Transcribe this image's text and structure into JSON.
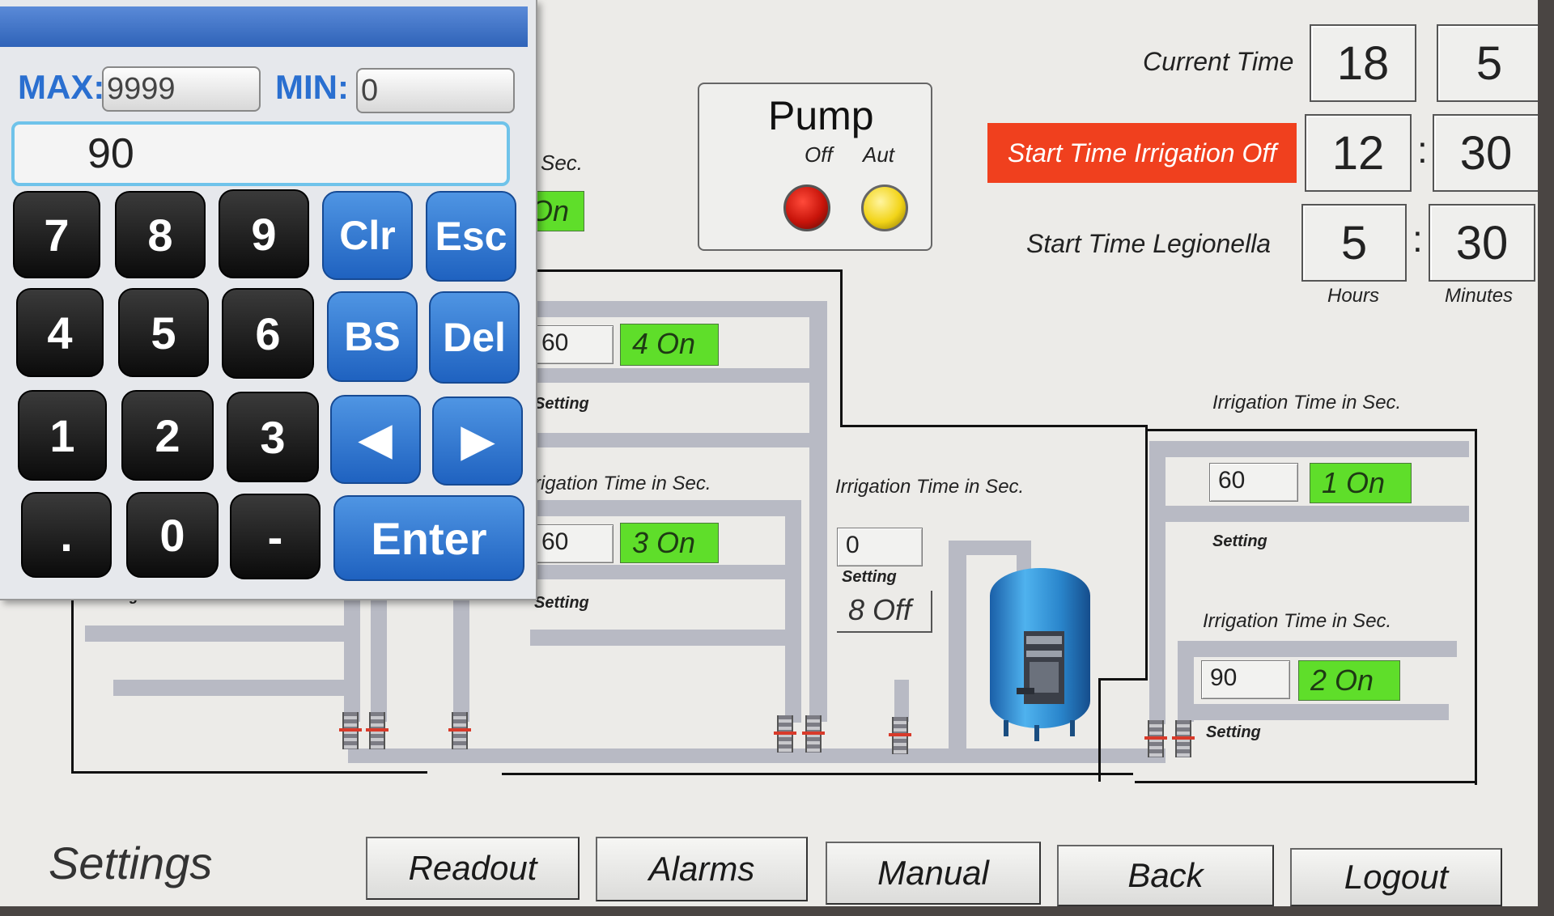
{
  "header": {
    "current_time_label": "Current Time",
    "current_time_hour": "18",
    "current_time_minute": "5",
    "start_irrigation_button": "Start Time Irrigation Off",
    "start_irrigation_hour": "12",
    "start_irrigation_minute": "30",
    "legionella_label": "Start Time Legionella",
    "legionella_hour": "5",
    "legionella_minute": "30",
    "hours_label": "Hours",
    "minutes_label": "Minutes",
    "colon": ":"
  },
  "pump": {
    "title": "Pump",
    "off_label": "Off",
    "auto_label": "Aut",
    "off_color": "#c8140a",
    "auto_color": "#f2d418"
  },
  "zones": {
    "partial_sec": "Sec.",
    "partial_on": "On",
    "zone4": {
      "value": "60",
      "status": "4 On",
      "setting": "Setting"
    },
    "zone3": {
      "title": "rigation Time in Sec.",
      "value": "60",
      "status": "3 On",
      "setting": "Setting"
    },
    "zone8": {
      "title": "Irrigation Time in Sec.",
      "value": "0",
      "setting": "Setting",
      "status": "8 Off"
    },
    "zone1": {
      "title": "Irrigation Time in Sec.",
      "value": "60",
      "status": "1 On",
      "setting": "Setting"
    },
    "zone2": {
      "title": "Irrigation Time in Sec.",
      "value": "90",
      "status": "2 On",
      "setting": "Setting"
    },
    "left_setting": "Setting"
  },
  "keypad": {
    "max_label": "MAX:",
    "max_value": "9999",
    "min_label": "MIN:",
    "min_value": "0",
    "display_value": "90",
    "keys": {
      "k7": "7",
      "k8": "8",
      "k9": "9",
      "clr": "Clr",
      "esc": "Esc",
      "k4": "4",
      "k5": "5",
      "k6": "6",
      "bs": "BS",
      "del": "Del",
      "k1": "1",
      "k2": "2",
      "k3": "3",
      "left": "◀",
      "right": "▶",
      "dot": ".",
      "k0": "0",
      "minus": "-",
      "enter": "Enter"
    }
  },
  "footer": {
    "page_title": "Settings",
    "readout": "Readout",
    "alarms": "Alarms",
    "manual": "Manual",
    "back": "Back",
    "logout": "Logout"
  },
  "colors": {
    "status_on": "#5fde2a",
    "start_button": "#f0401e",
    "keypad_blue": "#2a6fd0"
  }
}
